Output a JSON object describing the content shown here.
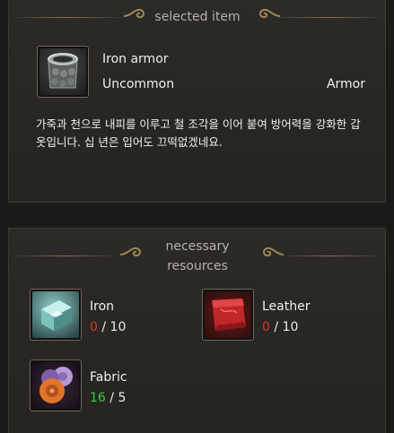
{
  "selected": {
    "header": "selected item",
    "item_name": "Iron armor",
    "rarity": "Uncommon",
    "category": "Armor",
    "description": "가죽과 천으로 내피를 이루고 철 조각을 이어 붙여 방어력을 강화한 갑옷입니다. 십 년은 입어도 끄떡없겠네요.",
    "icon": "iron-armor-icon"
  },
  "resources": {
    "header_line1": "necessary",
    "header_line2": "resources",
    "items": [
      {
        "name": "Iron",
        "have": "0",
        "need": "10",
        "have_status": "insufficient",
        "icon": "iron-ingot-icon"
      },
      {
        "name": "Leather",
        "have": "0",
        "need": "10",
        "have_status": "insufficient",
        "icon": "leather-icon"
      },
      {
        "name": "Fabric",
        "have": "16",
        "need": "5",
        "have_status": "sufficient",
        "icon": "fabric-rolls-icon"
      }
    ]
  },
  "colors": {
    "insufficient": "#e0302a",
    "sufficient": "#35d13a",
    "ornament": "#a08856"
  }
}
